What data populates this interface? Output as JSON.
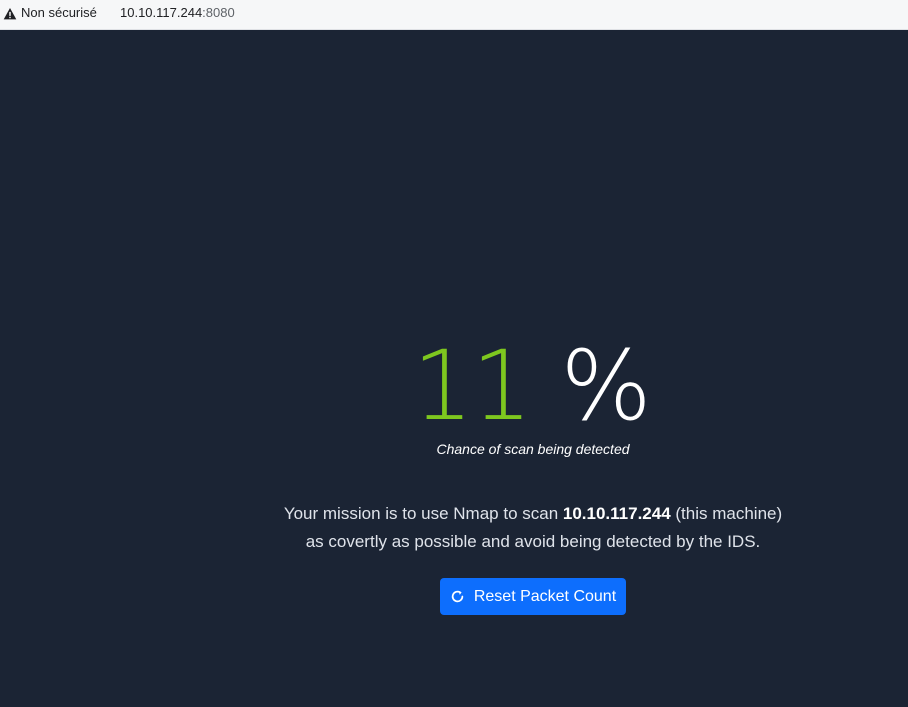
{
  "browser": {
    "security_label": "Non sécurisé",
    "url_host": "10.10.117.244",
    "url_port": ":8080",
    "icon": "warning-icon"
  },
  "detection": {
    "value": "11",
    "unit": "%",
    "caption": "Chance of scan being detected",
    "value_color": "#7ec71f"
  },
  "mission": {
    "line1_prefix": "Your mission is to use Nmap to scan ",
    "ip": "10.10.117.244",
    "line1_suffix": " (this machine)",
    "line2": "as covertly as possible and avoid being detected by the IDS."
  },
  "reset_button": {
    "label": "Reset Packet Count",
    "icon": "refresh-icon",
    "color": "#0d6efd"
  }
}
